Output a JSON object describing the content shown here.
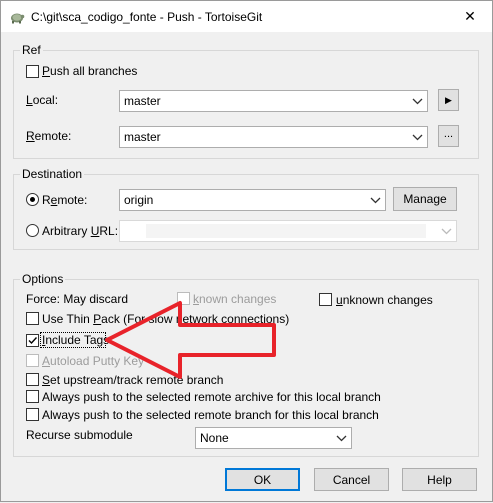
{
  "window": {
    "title": "C:\\git\\sca_codigo_fonte - Push - TortoiseGit",
    "close_glyph": "✕"
  },
  "ref": {
    "legend": "Ref",
    "push_all_branches": {
      "underline_char": "P",
      "rest": "ush all branches",
      "checked": false
    },
    "local": {
      "underline_char": "L",
      "rest": "ocal:",
      "value": "master",
      "button_glyph": "▶"
    },
    "remote": {
      "underline_char": "R",
      "rest": "emote:",
      "value": "master",
      "button_glyph": "..."
    }
  },
  "destination": {
    "legend": "Destination",
    "remote": {
      "pre": "R",
      "underline_char": "e",
      "rest": "mote:",
      "value": "origin",
      "selected": true
    },
    "manage_label": "Manage",
    "arbitrary_url": {
      "pre": "Arbitrary ",
      "underline_char": "U",
      "rest": "RL:",
      "value": "",
      "selected": false
    }
  },
  "options": {
    "legend": "Options",
    "force_label": "Force: May discard",
    "known_changes": {
      "underline_char": "k",
      "rest": "nown changes",
      "checked": false,
      "enabled": false
    },
    "unknown_changes": {
      "underline_char": "u",
      "rest": "nknown changes",
      "checked": false,
      "enabled": true
    },
    "use_thin_pack": {
      "pre": "Use Thin ",
      "underline_char": "P",
      "rest": "ack (For slow network connections)",
      "checked": false
    },
    "include_tags": {
      "underline_char": "I",
      "rest": "nclude Tags",
      "checked": true
    },
    "autoload_putty": {
      "underline_char": "A",
      "rest": "utoload Putty Key",
      "checked": false,
      "enabled": false
    },
    "set_upstream": {
      "underline_char": "S",
      "rest": "et upstream/track remote branch",
      "checked": false
    },
    "always_push_archive": {
      "label": "Always push to the selected remote archive for this local branch",
      "checked": false
    },
    "always_push_branch": {
      "label": "Always push to the selected remote branch for this local branch",
      "checked": false
    },
    "recurse_submodule": {
      "label": "Recurse submodule",
      "value": "None"
    }
  },
  "buttons": {
    "ok": "OK",
    "cancel": "Cancel",
    "help": "Help"
  },
  "annotation": {
    "color": "#e8232a"
  }
}
